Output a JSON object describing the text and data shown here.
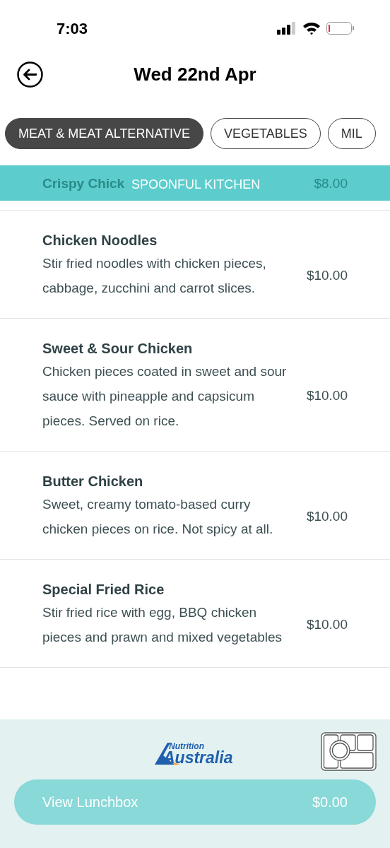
{
  "status_bar": {
    "time": "7:03"
  },
  "header": {
    "title": "Wed 22nd Apr"
  },
  "tabs": [
    {
      "label": "MEAT & MEAT ALTERNATIVE",
      "selected": true
    },
    {
      "label": "VEGETABLES",
      "selected": false
    },
    {
      "label": "MIL",
      "selected": false
    }
  ],
  "section_header": {
    "title": "SPOONFUL KITCHEN"
  },
  "covered_item": {
    "name": "Crispy Chick",
    "price": "$8.00"
  },
  "items": [
    {
      "name": "Chicken Noodles",
      "description": "Stir fried noodles with chicken pieces, cabbage, zucchini and carrot slices.",
      "price": "$10.00"
    },
    {
      "name": "Sweet & Sour Chicken",
      "description": "Chicken pieces coated in sweet and sour sauce with pineapple and capsicum pieces. Served on rice.",
      "price": "$10.00"
    },
    {
      "name": "Butter Chicken",
      "description": "Sweet, creamy tomato-based curry chicken pieces on rice. Not spicy at all.",
      "price": "$10.00"
    },
    {
      "name": "Special Fried Rice",
      "description": "Stir fried rice with egg, BBQ chicken pieces and prawn and mixed vegetables",
      "price": "$10.00"
    }
  ],
  "footer": {
    "logo_top": "Nutrition",
    "logo_bottom": "Australia",
    "button_label": "View Lunchbox",
    "total": "$0.00"
  }
}
